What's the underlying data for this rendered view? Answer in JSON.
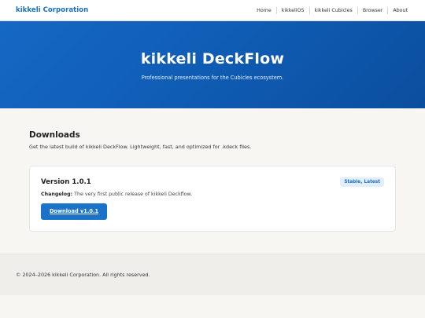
{
  "header": {
    "brand": "kikkeli Corporation",
    "nav": [
      {
        "label": "Home"
      },
      {
        "label": "kikkeliOS"
      },
      {
        "label": "kikkeli Cubicles"
      },
      {
        "label": "Browser"
      },
      {
        "label": "About"
      }
    ]
  },
  "hero": {
    "title": "kikkeli DeckFlow",
    "subtitle": "Professional presentations for the Cubicles ecosystem."
  },
  "downloads": {
    "heading": "Downloads",
    "intro": "Get the latest build of kikkeli DeckFlow. Lightweight, fast, and optimized for .kdeck files.",
    "release": {
      "version": "Version 1.0.1",
      "badge": "Stable, Latest",
      "changelog_label": "Changelog:",
      "changelog_text": " The very first public release of kikkeli Deckflow.",
      "button": "Download v1.0.1"
    }
  },
  "footer": {
    "copyright": "© 2024–2026 kikkeli Corporation. All rights reserved."
  },
  "colors": {
    "accent": "#1a6fc2",
    "hero_gradient_start": "#1568c4",
    "hero_gradient_end": "#0b4e9e"
  }
}
